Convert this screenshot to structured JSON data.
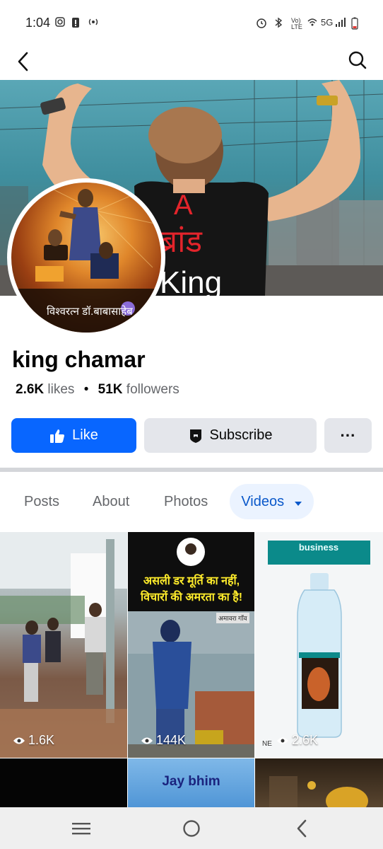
{
  "status_bar": {
    "time": "1:04",
    "network": "5G",
    "lte": "LTE"
  },
  "cover": {
    "text_a": "A",
    "text_brand": "ब्रांड",
    "text_king": "King"
  },
  "avatar": {
    "caption": "विश्वरत्न डॉ.बाबासाहेब"
  },
  "page": {
    "name": "king chamar",
    "likes_count": "2.6K",
    "likes_label": "likes",
    "separator": "•",
    "followers_count": "51K",
    "followers_label": "followers"
  },
  "actions": {
    "like_label": "Like",
    "subscribe_label": "Subscribe",
    "more_label": "···"
  },
  "tabs": [
    {
      "label": "Posts",
      "active": false
    },
    {
      "label": "About",
      "active": false
    },
    {
      "label": "Photos",
      "active": false
    },
    {
      "label": "Videos",
      "active": true
    }
  ],
  "videos": [
    {
      "views": "1.6K",
      "overlay_text": ""
    },
    {
      "views": "144K",
      "overlay_text": "असली डर मूर्ति का नहीं, विचारों की अमरता का है!",
      "sub_text": "अमावरा गाँव"
    },
    {
      "views": "2.6K",
      "overlay_text": "business",
      "footer_text": "NE"
    },
    {
      "views": "",
      "overlay_text": ""
    },
    {
      "views": "",
      "overlay_text": "Jay bhim"
    },
    {
      "views": "",
      "overlay_text": ""
    }
  ],
  "colors": {
    "brand_blue": "#0866ff",
    "tab_active_bg": "#ebf3ff",
    "tab_active_text": "#0a58ca",
    "secondary_button": "#e4e6eb"
  }
}
